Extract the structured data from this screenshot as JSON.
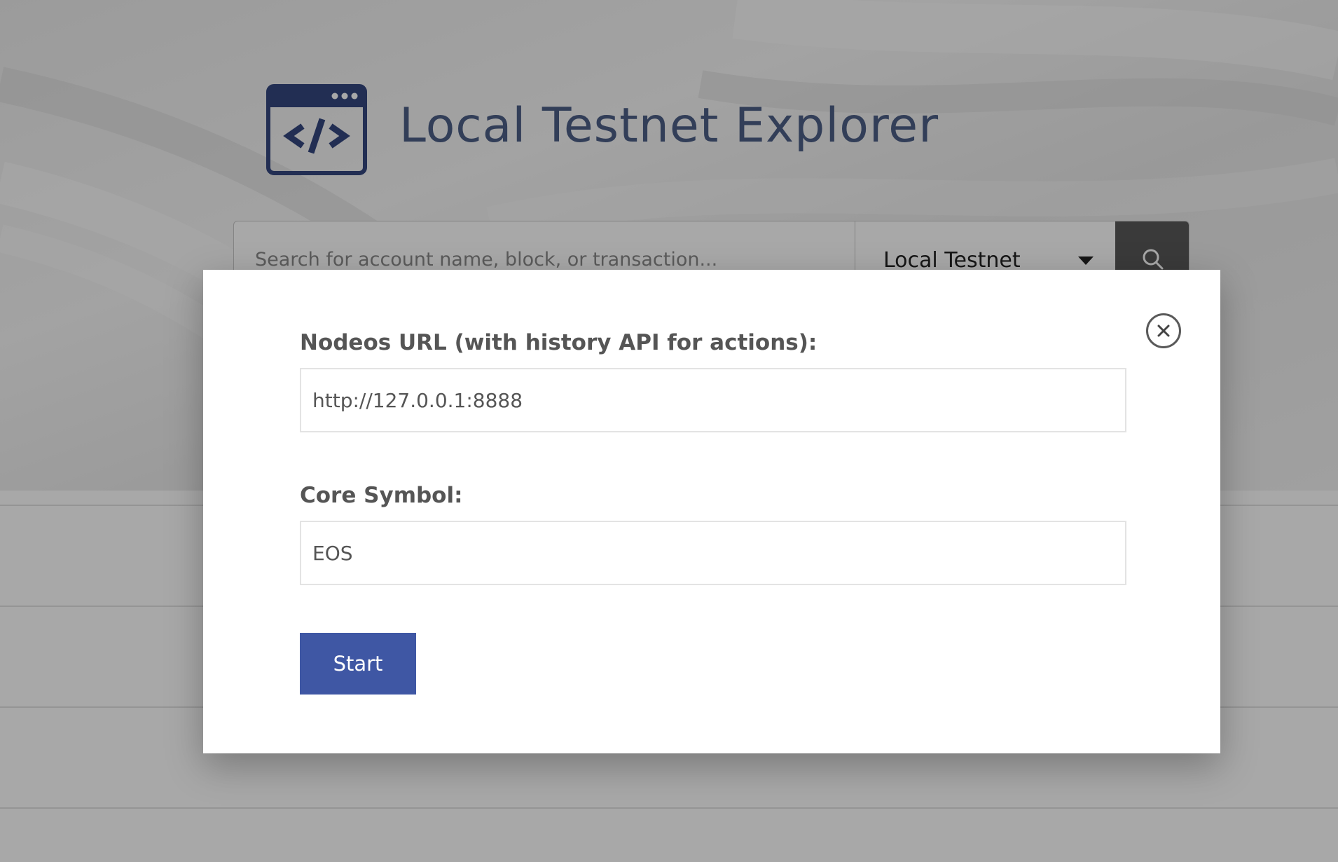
{
  "header": {
    "app_title": "Local Testnet Explorer",
    "logo_icon": "code-window-icon"
  },
  "search": {
    "placeholder": "Search for account name, block, or transaction...",
    "network_selected": "Local Testnet",
    "search_icon": "search-icon"
  },
  "modal": {
    "nodeos_label": "Nodeos URL (with history API for actions):",
    "nodeos_value": "http://127.0.0.1:8888",
    "core_symbol_label": "Core Symbol:",
    "core_symbol_value": "EOS",
    "start_label": "Start",
    "close_icon": "close-icon"
  },
  "colors": {
    "brand_blue": "#3f57a4",
    "title_slate": "#4d5f86",
    "search_button": "#595959"
  }
}
